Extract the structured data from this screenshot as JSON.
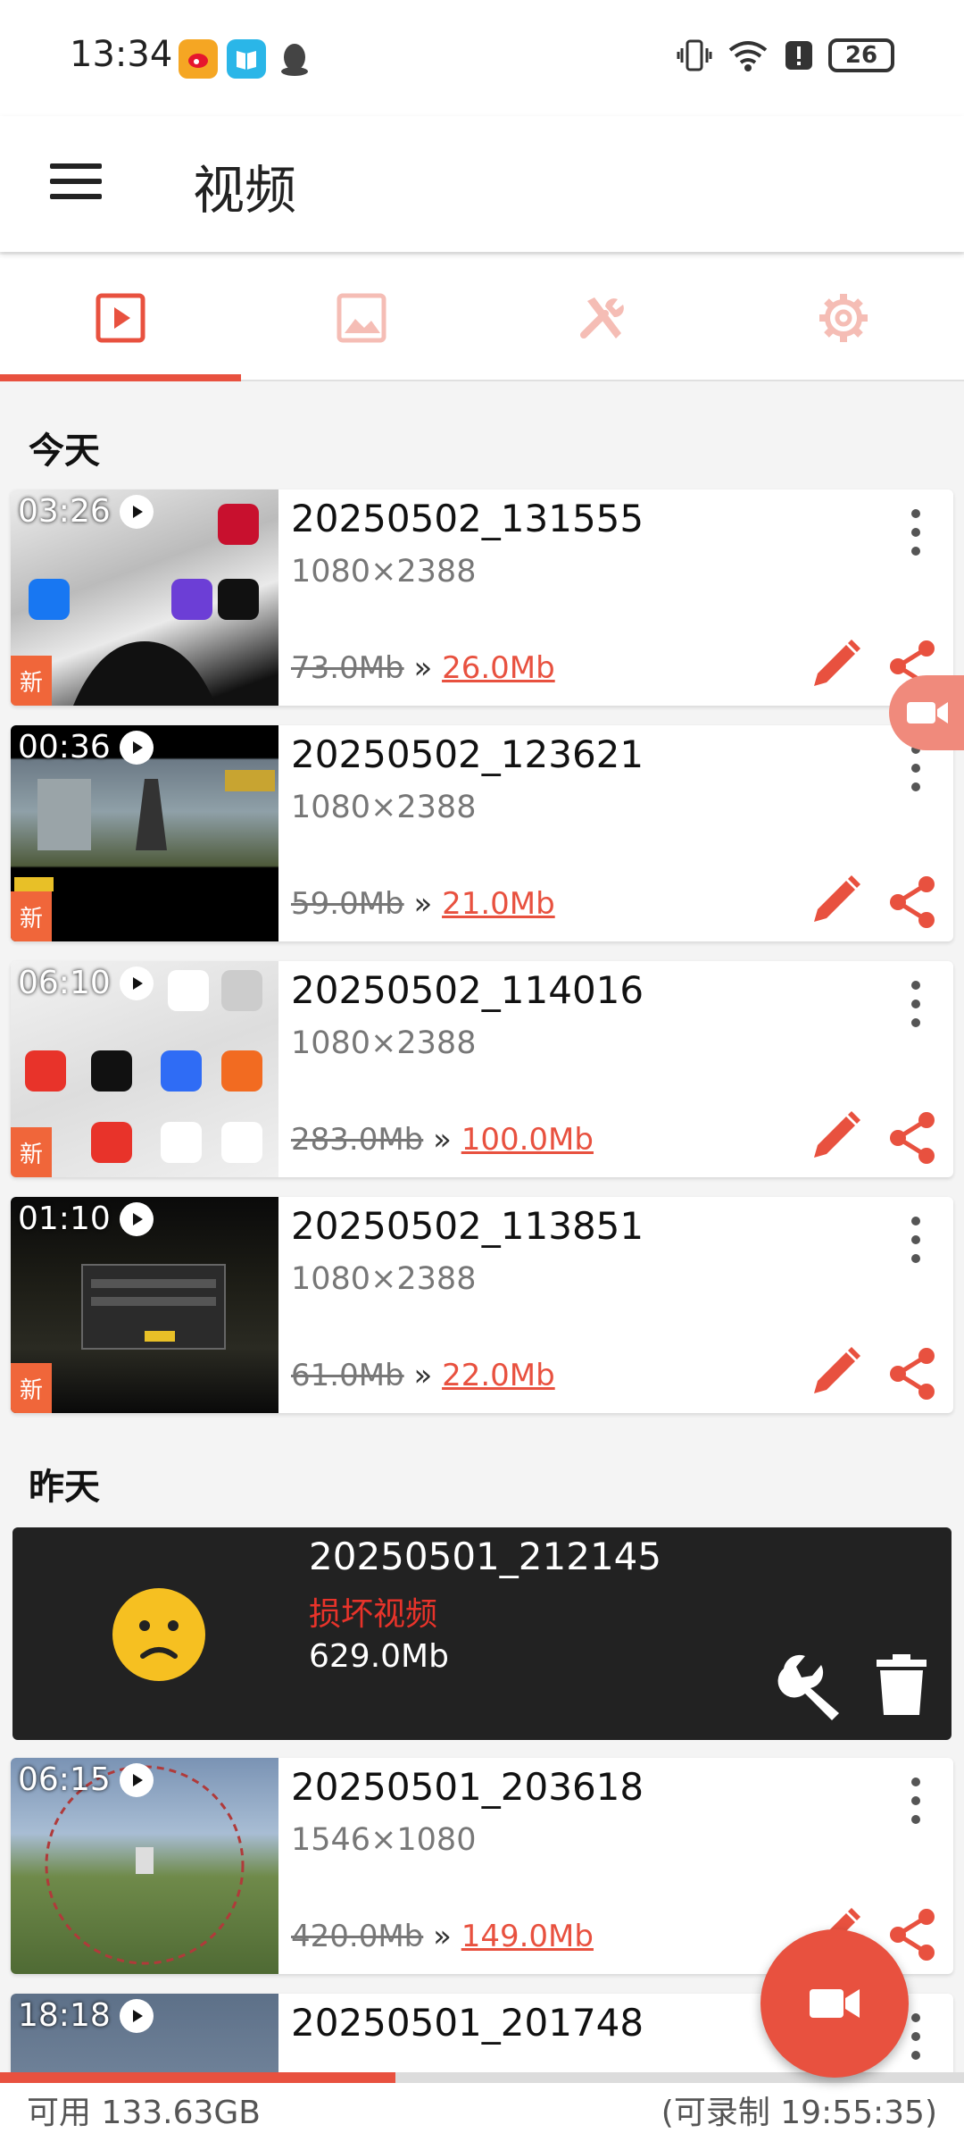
{
  "status_bar": {
    "time": "13:34",
    "battery": "26"
  },
  "app_bar": {
    "title": "视频"
  },
  "tabs": [
    {
      "name": "videos",
      "icon": "play-icon",
      "active": true
    },
    {
      "name": "images",
      "icon": "image-icon",
      "active": false
    },
    {
      "name": "tools",
      "icon": "tools-icon",
      "active": false
    },
    {
      "name": "settings",
      "icon": "settings-icon",
      "active": false
    }
  ],
  "sections": {
    "today": "今天",
    "yesterday": "昨天"
  },
  "separator": "»",
  "videos": [
    {
      "duration": "03:26",
      "name": "20250502_131555",
      "resolution": "1080×2388",
      "size_old": "73.0Mb",
      "size_new": "26.0Mb",
      "badge": "新"
    },
    {
      "duration": "00:36",
      "name": "20250502_123621",
      "resolution": "1080×2388",
      "size_old": "59.0Mb",
      "size_new": "21.0Mb",
      "badge": "新"
    },
    {
      "duration": "06:10",
      "name": "20250502_114016",
      "resolution": "1080×2388",
      "size_old": "283.0Mb",
      "size_new": "100.0Mb",
      "badge": "新"
    },
    {
      "duration": "01:10",
      "name": "20250502_113851",
      "resolution": "1080×2388",
      "size_old": "61.0Mb",
      "size_new": "22.0Mb",
      "badge": "新"
    },
    {
      "duration": "06:15",
      "name": "20250501_203618",
      "resolution": "1546×1080",
      "size_old": "420.0Mb",
      "size_new": "149.0Mb"
    },
    {
      "duration": "18:18",
      "name": "20250501_201748"
    }
  ],
  "broken_video": {
    "name": "20250501_212145",
    "label": "损坏视频",
    "size": "629.0Mb"
  },
  "footer": {
    "available": "可用 133.63GB",
    "recordable": "(可录制 19:55:35)",
    "storage_used_fraction": 0.41
  },
  "colors": {
    "accent": "#e8513f",
    "broken_bg": "#222222",
    "badge": "#f0663a"
  }
}
